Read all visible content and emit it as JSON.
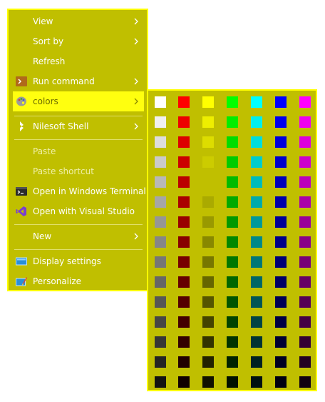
{
  "menu": {
    "background": "#c0bf00",
    "border": "#ffff00",
    "items": [
      {
        "label": "View",
        "submenu": true,
        "icon": ""
      },
      {
        "label": "Sort by",
        "submenu": true,
        "icon": ""
      },
      {
        "label": "Refresh",
        "submenu": false,
        "icon": ""
      },
      {
        "label": "Run command",
        "submenu": true,
        "icon": "terminal-prompt-icon"
      },
      {
        "label": "colors",
        "submenu": true,
        "icon": "palette-icon",
        "highlighted": true
      },
      {
        "label": "Nilesoft Shell",
        "submenu": true,
        "icon": "nilesoft-shell-icon"
      },
      {
        "label": "Paste",
        "submenu": false,
        "icon": "",
        "disabled": true
      },
      {
        "label": "Paste shortcut",
        "submenu": false,
        "icon": "",
        "disabled": true
      },
      {
        "label": "Open in Windows Terminal",
        "submenu": false,
        "icon": "windows-terminal-icon"
      },
      {
        "label": "Open with Visual Studio",
        "submenu": false,
        "icon": "visual-studio-icon"
      },
      {
        "label": "New",
        "submenu": true,
        "icon": ""
      },
      {
        "label": "Display settings",
        "submenu": false,
        "icon": "display-icon"
      },
      {
        "label": "Personalize",
        "submenu": false,
        "icon": "personalize-icon"
      }
    ]
  },
  "palette": {
    "background": "#c0bf00",
    "border": "#ffff00",
    "columns": [
      [
        "#ffffff",
        "#f0f0f0",
        "#dddddd",
        "#cacaca",
        "#b8b8b8",
        "#a6a6a6",
        "#969696",
        "#868686",
        "#767676",
        "#666666",
        "#565656",
        "#464646",
        "#363636",
        "#242424",
        "#121212"
      ],
      [
        "#ff0000",
        "#ee0000",
        "#dd0000",
        "#cc0000",
        "#bb0000",
        "#aa0000",
        "#990000",
        "#880000",
        "#770000",
        "#660000",
        "#550000",
        "#440000",
        "#330000",
        "#220000",
        "#110000"
      ],
      [
        "#ffff00",
        "#eeee00",
        "#dddd00",
        "#cccc00",
        "#c0bf00",
        "#aaaa00",
        "#999900",
        "#888800",
        "#777700",
        "#666600",
        "#555500",
        "#444400",
        "#333300",
        "#222200",
        "#111100"
      ],
      [
        "#00ff00",
        "#00ee00",
        "#00dd00",
        "#00cc00",
        "#00bb00",
        "#00aa00",
        "#009900",
        "#008800",
        "#007700",
        "#006600",
        "#005500",
        "#004400",
        "#003300",
        "#002200",
        "#001100"
      ],
      [
        "#00ffff",
        "#00eeee",
        "#00dddd",
        "#00cccc",
        "#00bbbb",
        "#00aaaa",
        "#009999",
        "#008888",
        "#007777",
        "#006666",
        "#005555",
        "#004444",
        "#003333",
        "#002222",
        "#001111"
      ],
      [
        "#0000ff",
        "#0000ee",
        "#0000dd",
        "#0000cc",
        "#0000bb",
        "#0000aa",
        "#000099",
        "#000088",
        "#000077",
        "#000066",
        "#000055",
        "#000044",
        "#000033",
        "#000022",
        "#000011"
      ],
      [
        "#ff00ff",
        "#ee00ee",
        "#dd00dd",
        "#cc00cc",
        "#bb00bb",
        "#aa00aa",
        "#990099",
        "#880088",
        "#770077",
        "#660066",
        "#550055",
        "#440044",
        "#330033",
        "#220022",
        "#110011"
      ]
    ]
  }
}
